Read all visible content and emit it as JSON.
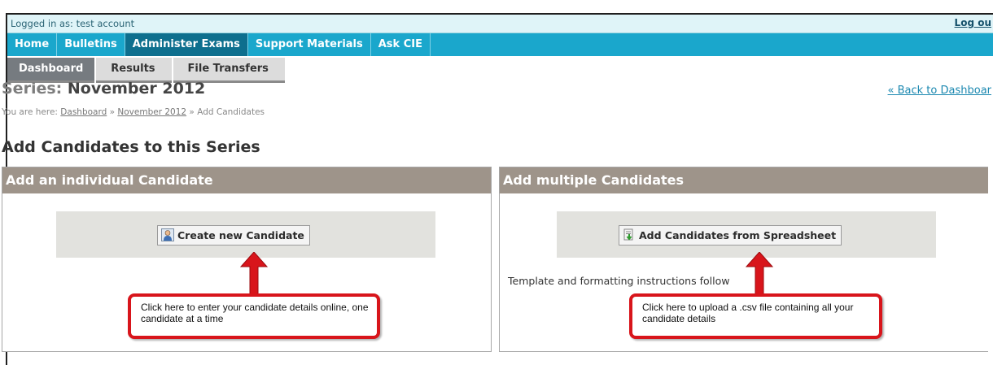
{
  "topbar": {
    "logged_in": "Logged in as: test account",
    "logout": "Log ou"
  },
  "main_nav": [
    {
      "label": "Home"
    },
    {
      "label": "Bulletins"
    },
    {
      "label": "Administer Exams"
    },
    {
      "label": "Support Materials"
    },
    {
      "label": "Ask CIE"
    }
  ],
  "sub_nav": [
    {
      "label": "Dashboard"
    },
    {
      "label": "Results"
    },
    {
      "label": "File Transfers"
    }
  ],
  "series": {
    "prefix": "Series:",
    "name": "November 2012"
  },
  "back_link": "« Back to Dashboar",
  "breadcrumb": {
    "prefix": "You are here:",
    "dashboard": "Dashboard",
    "sep": "»",
    "series": "November 2012",
    "current": "Add Candidates"
  },
  "page_heading": "Add Candidates to this Series",
  "left_panel": {
    "title": "Add an individual Candidate",
    "button": "Create new Candidate",
    "icon": "person-icon",
    "callout": "Click here to enter your candidate details online, one candidate at a time"
  },
  "right_panel": {
    "title": "Add multiple Candidates",
    "button": "Add Candidates from Spreadsheet",
    "icon": "spreadsheet-download-icon",
    "note": "Template and formatting instructions follow",
    "callout": "Click here to upload a .csv file containing all your candidate details"
  },
  "colors": {
    "nav": "#1aa7cc",
    "nav_active": "#0e6f8e",
    "panel_header": "#9e948a",
    "callout_border": "#d8151b"
  }
}
